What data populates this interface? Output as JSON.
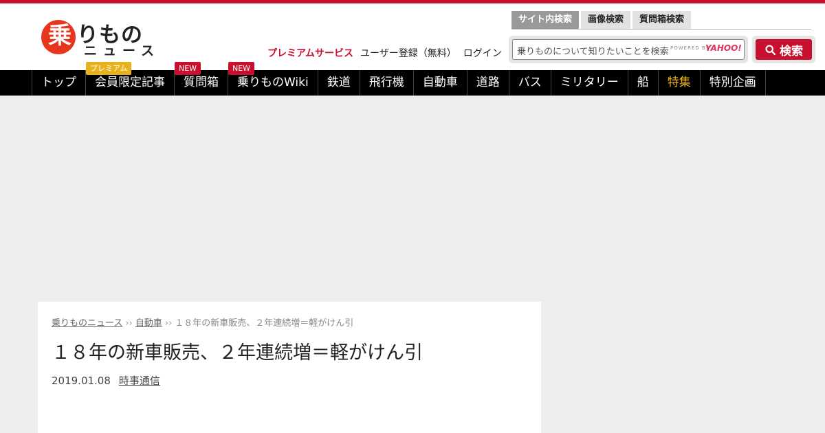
{
  "logo": {
    "badge": "乗",
    "main": "りもの",
    "sub": "ニュース"
  },
  "search_tabs": [
    {
      "label": "サイト内検索",
      "active": true
    },
    {
      "label": "画像検索",
      "active": false
    },
    {
      "label": "質問箱検索",
      "active": false
    }
  ],
  "header_links": {
    "premium": "プレミアムサービス",
    "register": "ユーザー登録（無料）",
    "login": "ログイン"
  },
  "search": {
    "placeholder": "乗りものについて知りたいことを検索",
    "powered_by": "POWERED BY",
    "provider": "YAHOO!",
    "button_label": "検索",
    "button_icon": "search-icon"
  },
  "nav": [
    {
      "label": "トップ"
    },
    {
      "label": "会員限定記事",
      "badge": "プレミアム",
      "badge_style": "gold"
    },
    {
      "label": "質問箱",
      "badge": "NEW",
      "badge_style": "red"
    },
    {
      "label": "乗りものWiki",
      "badge": "NEW",
      "badge_style": "red"
    },
    {
      "label": "鉄道"
    },
    {
      "label": "飛行機"
    },
    {
      "label": "自動車"
    },
    {
      "label": "道路"
    },
    {
      "label": "バス"
    },
    {
      "label": "ミリタリー"
    },
    {
      "label": "船"
    },
    {
      "label": "特集",
      "highlight": true
    },
    {
      "label": "特別企画"
    }
  ],
  "breadcrumb": {
    "home": "乗りものニュース",
    "category": "自動車",
    "current": "１８年の新車販売、２年連続増＝軽がけん引",
    "separator": "››"
  },
  "article": {
    "title": "１８年の新車販売、２年連続増＝軽がけん引",
    "date": "2019.01.08",
    "source": "時事通信"
  },
  "colors": {
    "brand_red": "#c8102e",
    "logo_red": "#e8351d",
    "nav_bg": "#000000",
    "highlight_gold": "#f2b21c"
  }
}
